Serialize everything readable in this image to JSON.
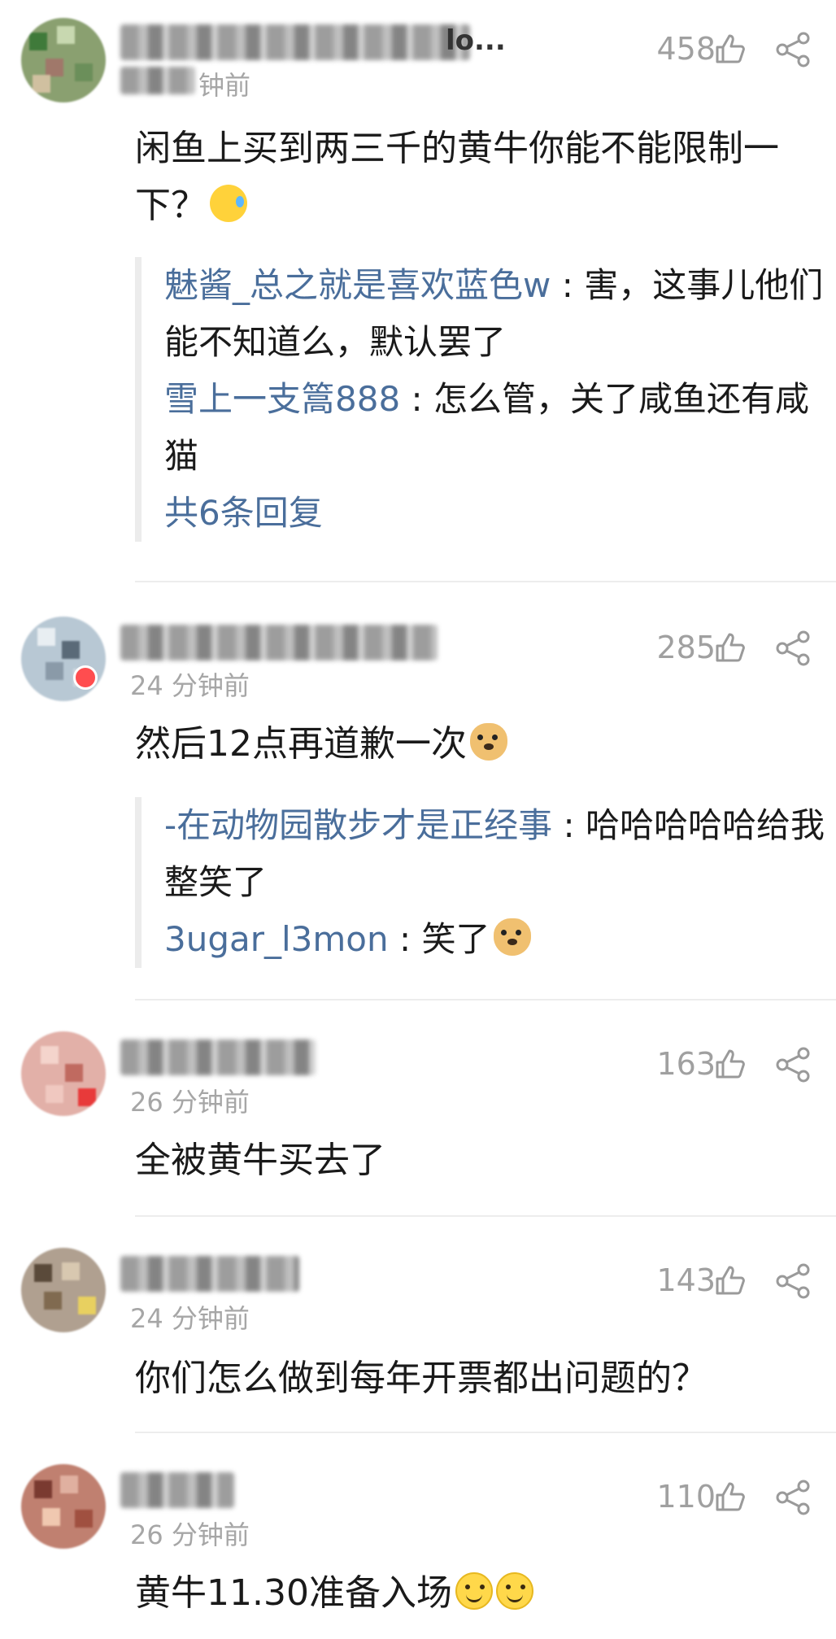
{
  "comments": [
    {
      "name_tail": "lo...",
      "time": "钟前",
      "likes": "458",
      "text": "闲鱼上买到两三千的黄牛你能不能限制一下？",
      "replies": [
        {
          "user": "魅酱_总之就是喜欢蓝色w",
          "text": "害，这事儿他们能不知道么，默认罢了"
        },
        {
          "user": "雪上一支篙888",
          "text": "怎么管，关了咸鱼还有咸猫"
        }
      ],
      "more": "共6条回复"
    },
    {
      "name_tail": "",
      "time": "24 分钟前",
      "likes": "285",
      "text": "然后12点再道歉一次",
      "replies": [
        {
          "user": "-在动物园散步才是正经事",
          "text": "哈哈哈哈哈给我整笑了"
        },
        {
          "user": "3ugar_l3mon",
          "text": "笑了"
        }
      ]
    },
    {
      "name_tail": "",
      "time": "26 分钟前",
      "likes": "163",
      "text": "全被黄牛买去了"
    },
    {
      "name_tail": "",
      "time": "24 分钟前",
      "likes": "143",
      "text": "你们怎么做到每年开票都出问题的？"
    },
    {
      "name_tail": "",
      "time": "26 分钟前",
      "likes": "110",
      "text": "黄牛11.30准备入场"
    }
  ],
  "icons": {
    "like": "thumbs-up-icon",
    "share": "share-icon",
    "emoji_sweat": "sweat-smile-emoji",
    "emoji_doge": "doge-emoji",
    "emoji_smile": "smile-emoji"
  },
  "colors": {
    "reply_user": "#4a6e9b",
    "meta_gray": "#a6a6a6",
    "divider": "#ededed"
  }
}
